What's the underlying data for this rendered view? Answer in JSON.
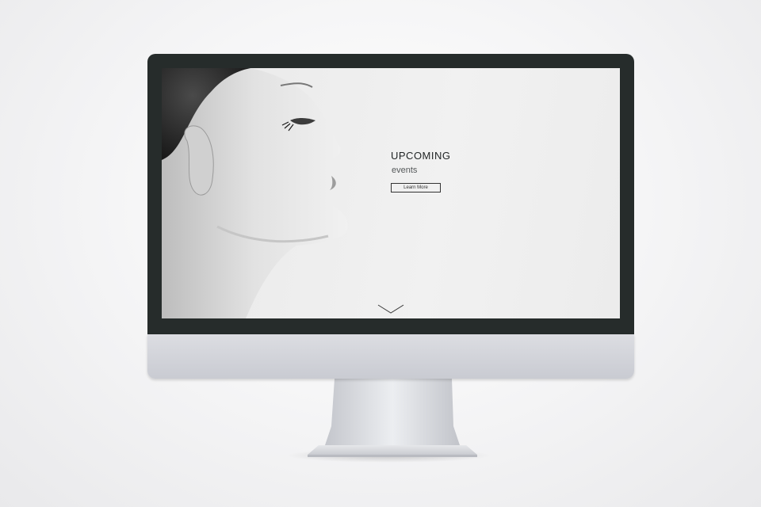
{
  "hero": {
    "title": "UPCOMING",
    "subtitle": "events",
    "button_label": "Learn More"
  },
  "icons": {
    "scroll_down": "chevron-down-icon"
  },
  "colors": {
    "bezel": "#262c2b",
    "screen_background": "#eeeeee",
    "text_dark": "#1f2324",
    "chin": "#d3d5db"
  }
}
